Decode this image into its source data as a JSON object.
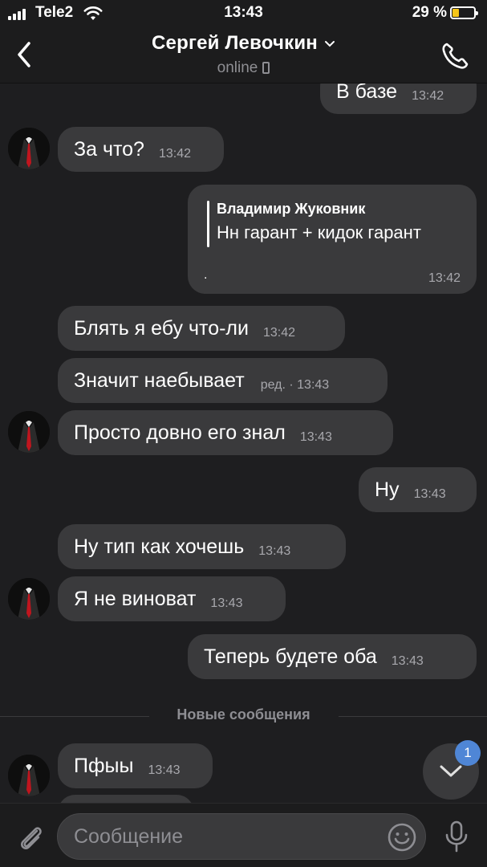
{
  "status_bar": {
    "carrier": "Tele2",
    "time": "13:43",
    "battery_percent": "29 %",
    "battery_level": 0.29,
    "battery_color": "#f5c518"
  },
  "header": {
    "contact_name": "Сергей Левочкин",
    "status": "online",
    "back_icon": "chevron-left-icon",
    "call_icon": "phone-icon"
  },
  "messages": [
    {
      "dir": "out",
      "text": "В базе",
      "time": "13:42"
    },
    {
      "dir": "in",
      "text": "За что?",
      "time": "13:42"
    },
    {
      "dir": "out",
      "reply_to_name": "Владимир Жуковник",
      "reply_to_text": "Нн гарант + кидок гарант",
      "text": ".",
      "time": "13:42"
    },
    {
      "dir": "in",
      "text": "Блять я ебу что-ли",
      "time": "13:42"
    },
    {
      "dir": "in",
      "text": "Значит наебывает",
      "edited": "ред. ·",
      "time": "13:43"
    },
    {
      "dir": "in",
      "text": "Просто довно его знал",
      "time": "13:43"
    },
    {
      "dir": "out",
      "text": "Ну",
      "time": "13:43"
    },
    {
      "dir": "in",
      "text": "Ну тип как хочешь",
      "time": "13:43"
    },
    {
      "dir": "in",
      "text": "Я не виноват",
      "time": "13:43"
    },
    {
      "dir": "out",
      "text": "Теперь будете оба",
      "time": "13:43"
    },
    {
      "dir": "in",
      "text": "Пфыы",
      "time": "13:43"
    }
  ],
  "new_messages_divider": "Новые сообщения",
  "scroll_down": {
    "badge": "1",
    "icon": "chevron-down-icon",
    "badge_color": "#4f86d6"
  },
  "composer": {
    "placeholder": "Сообщение",
    "attach_icon": "paperclip-icon",
    "emoji_icon": "emoji-icon",
    "mic_icon": "microphone-icon"
  },
  "colors": {
    "background": "#1e1e20",
    "bubble": "#3a3a3c",
    "bar": "#1c1c1d"
  }
}
